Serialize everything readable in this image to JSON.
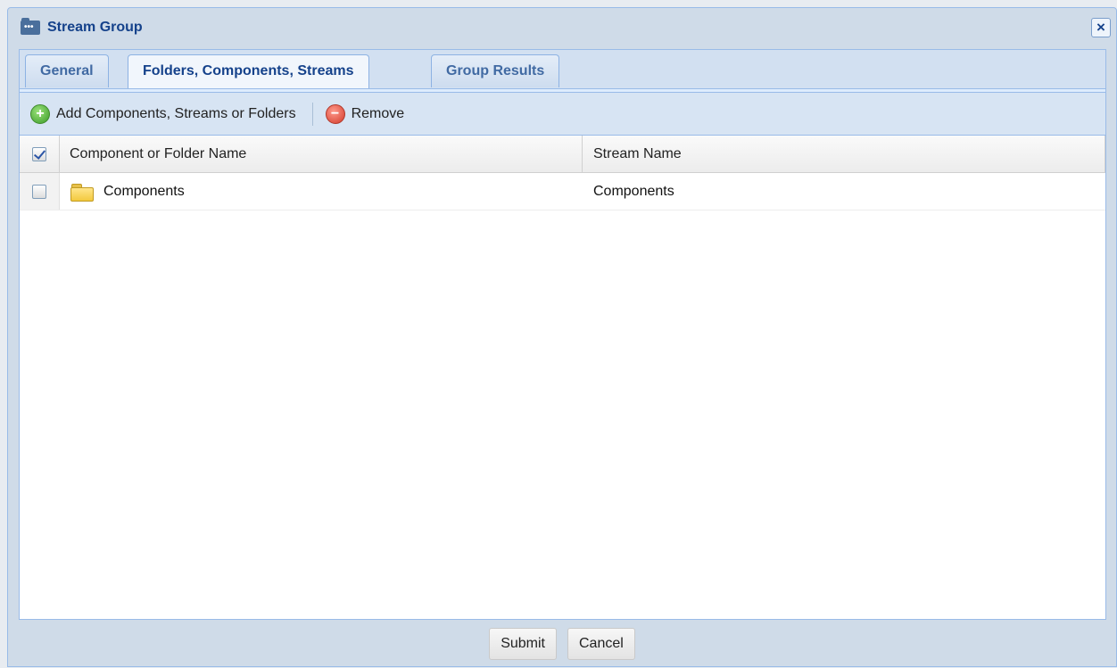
{
  "window": {
    "title": "Stream Group",
    "icon": "stream-group-icon",
    "close_icon": "close-icon"
  },
  "tabs": [
    {
      "label": "General",
      "active": false
    },
    {
      "label": "Folders, Components, Streams",
      "active": true
    },
    {
      "label": "Group Results",
      "active": false
    }
  ],
  "toolbar": {
    "add_label": "Add Components, Streams or Folders",
    "add_icon": "add-icon",
    "remove_label": "Remove",
    "remove_icon": "remove-icon"
  },
  "grid": {
    "select_all_checked": true,
    "columns": [
      "Component or Folder Name",
      "Stream Name"
    ],
    "rows": [
      {
        "checked": false,
        "icon": "folder-icon",
        "name": "Components",
        "stream": "Components"
      }
    ]
  },
  "footer": {
    "submit_label": "Submit",
    "cancel_label": "Cancel"
  }
}
